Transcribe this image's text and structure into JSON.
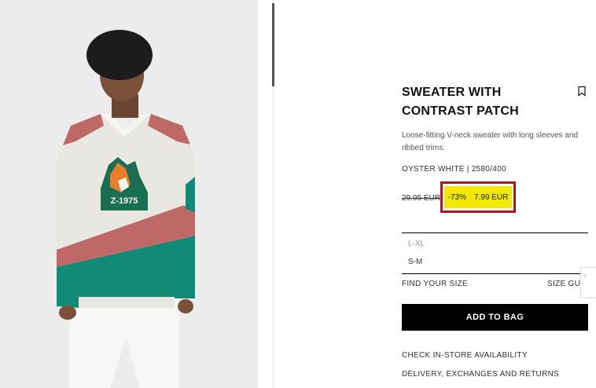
{
  "product": {
    "title": "SWEATER WITH CONTRAST PATCH",
    "description": "Loose-fitting V-neck sweater with long sleeves and ribbed trims.",
    "color_ref": "OYSTER WHITE | 2580/400",
    "original_price": "29.95 EUR",
    "discount": "-73%",
    "sale_price": "7.99 EUR",
    "patch_text": "Z-1975"
  },
  "sizes": [
    "L-XL",
    "S-M"
  ],
  "links": {
    "find_size": "FIND YOUR SIZE",
    "size_guide": "SIZE GUIDE",
    "add_to_bag": "ADD TO BAG",
    "store_availability": "CHECK IN-STORE AVAILABILITY",
    "delivery": "DELIVERY, EXCHANGES AND RETURNS"
  },
  "icons": {
    "bookmark": "bookmark-icon"
  },
  "colors": {
    "highlight_border": "#b0161f",
    "highlight_fill": "#f2e800",
    "sweater_green": "#118a76",
    "sweater_red": "#bf6868",
    "sweater_white": "#e9e7e2"
  }
}
